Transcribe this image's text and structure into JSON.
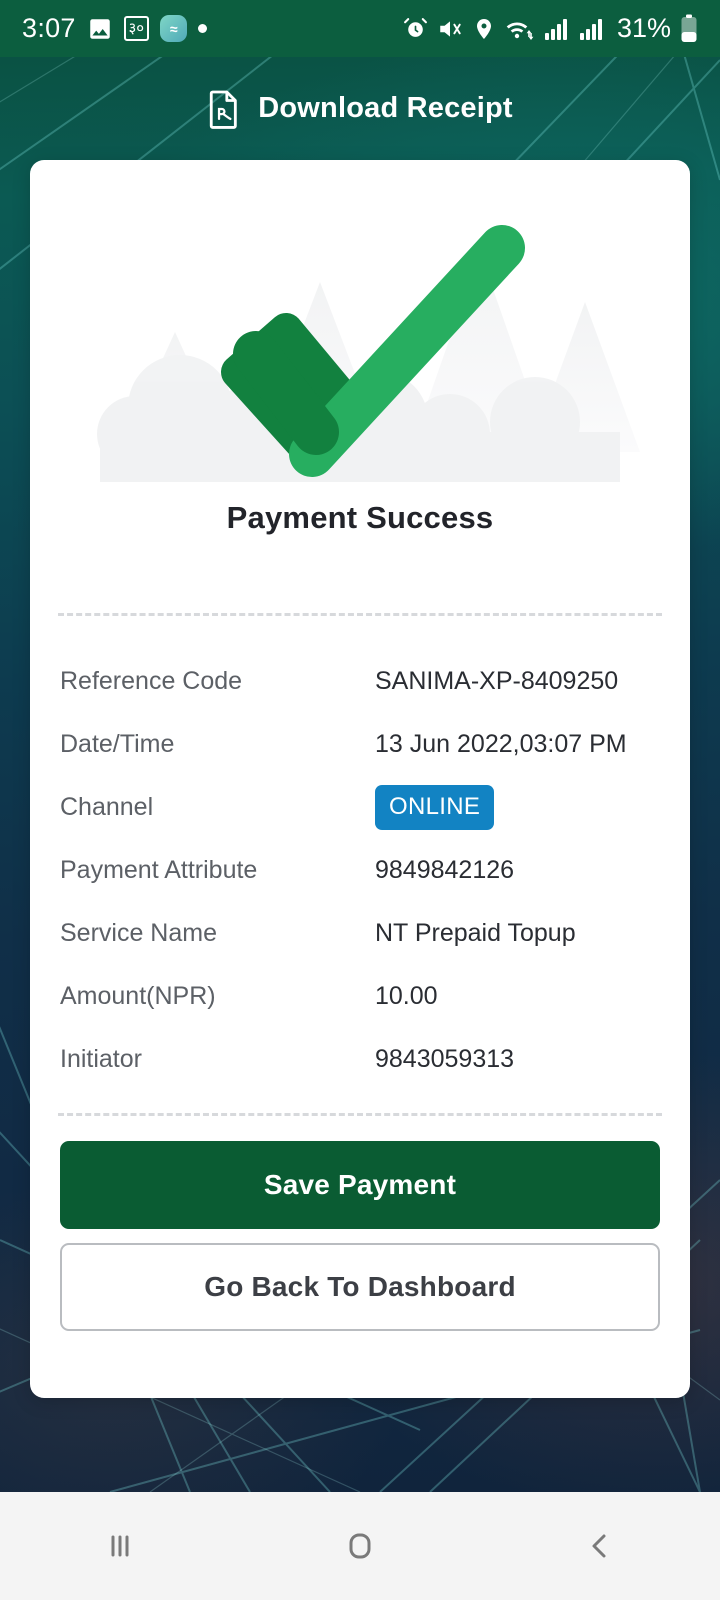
{
  "status_bar": {
    "time": "3:07",
    "battery_percent": "31%",
    "nepali_badge": "३०",
    "app_bubble_label": "≈",
    "left_icons": [
      "gallery-icon",
      "nepali-date-icon",
      "app-notification-icon",
      "dot-icon"
    ],
    "right_icons": [
      "alarm-icon",
      "mute-vibrate-icon",
      "location-icon",
      "wifi-icon",
      "signal-bars-icon",
      "signal-bars-2-icon",
      "battery-icon"
    ],
    "background_color": "#0c5e3f"
  },
  "header": {
    "title": "Download Receipt",
    "icon": "pdf-file-icon"
  },
  "card": {
    "illustration": "green-checkmark-mountains-illustration",
    "success_title": "Payment Success",
    "details": [
      {
        "label": "Reference Code",
        "value": "SANIMA-XP-8409250",
        "type": "text"
      },
      {
        "label": "Date/Time",
        "value": "13 Jun 2022,03:07 PM",
        "type": "text"
      },
      {
        "label": "Channel",
        "value": "ONLINE",
        "type": "badge"
      },
      {
        "label": "Payment Attribute",
        "value": "9849842126",
        "type": "text"
      },
      {
        "label": "Service Name",
        "value": "NT Prepaid Topup",
        "type": "text"
      },
      {
        "label": "Amount(NPR)",
        "value": "10.00",
        "type": "text"
      },
      {
        "label": "Initiator",
        "value": "9843059313",
        "type": "text"
      }
    ],
    "buttons": {
      "primary": "Save Payment",
      "secondary": "Go Back To Dashboard"
    }
  },
  "nav_bar": {
    "recents": "recents-icon",
    "home": "home-icon",
    "back": "back-icon"
  },
  "colors": {
    "status_bar_green": "#0c5e3f",
    "primary_button_green": "#0a5c33",
    "badge_blue": "#1283c3",
    "check_light": "#27ae60",
    "check_dark": "#12813f",
    "label_gray": "#5c6066",
    "value_dark": "#2a2d33"
  }
}
